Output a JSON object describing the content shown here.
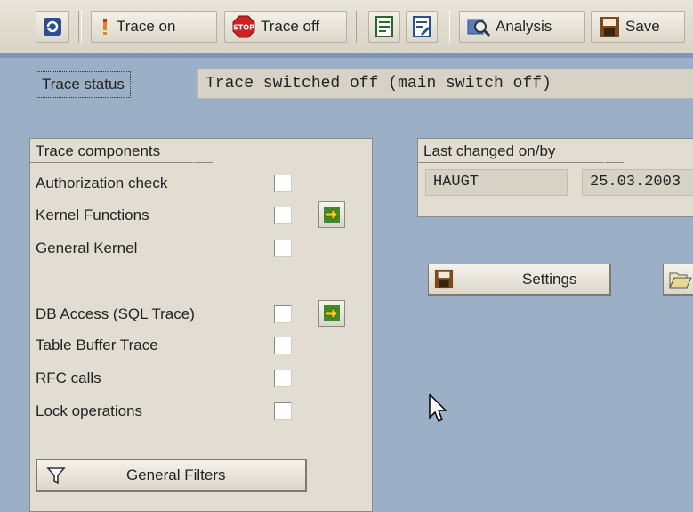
{
  "toolbar": {
    "trace_on_label": "Trace on",
    "trace_off_label": "Trace off",
    "analysis_label": "Analysis",
    "save_label": "Save"
  },
  "trace_status": {
    "label": "Trace status",
    "value": "Trace switched off (main switch off)"
  },
  "trace_components": {
    "title": "Trace components",
    "items": [
      {
        "label": "Authorization check",
        "checked": false
      },
      {
        "label": "Kernel Functions",
        "checked": false
      },
      {
        "label": "General Kernel",
        "checked": false
      },
      {
        "label": "DB Access (SQL Trace)",
        "checked": false
      },
      {
        "label": "Table Buffer Trace",
        "checked": false
      },
      {
        "label": "RFC calls",
        "checked": false
      },
      {
        "label": "Lock operations",
        "checked": false
      }
    ],
    "general_filters_label": "General Filters"
  },
  "last_changed": {
    "title": "Last changed on/by",
    "user": "HAUGT",
    "date": "25.03.2003"
  },
  "settings_label": "Settings",
  "icons": {
    "refresh": "refresh-icon",
    "trace_on": "trace-on-icon",
    "stop": "stop-icon",
    "document": "document-icon",
    "document2": "document-edit-icon",
    "analysis": "analysis-icon",
    "save": "save-icon",
    "arrow": "arrow-right-icon",
    "filter": "filter-icon",
    "folder": "folder-open-icon",
    "cursor": "mouse-cursor-icon"
  },
  "colors": {
    "background": "#9bb0c6",
    "panel": "#e1ddd3",
    "toolbar": "#dcd7ca"
  }
}
